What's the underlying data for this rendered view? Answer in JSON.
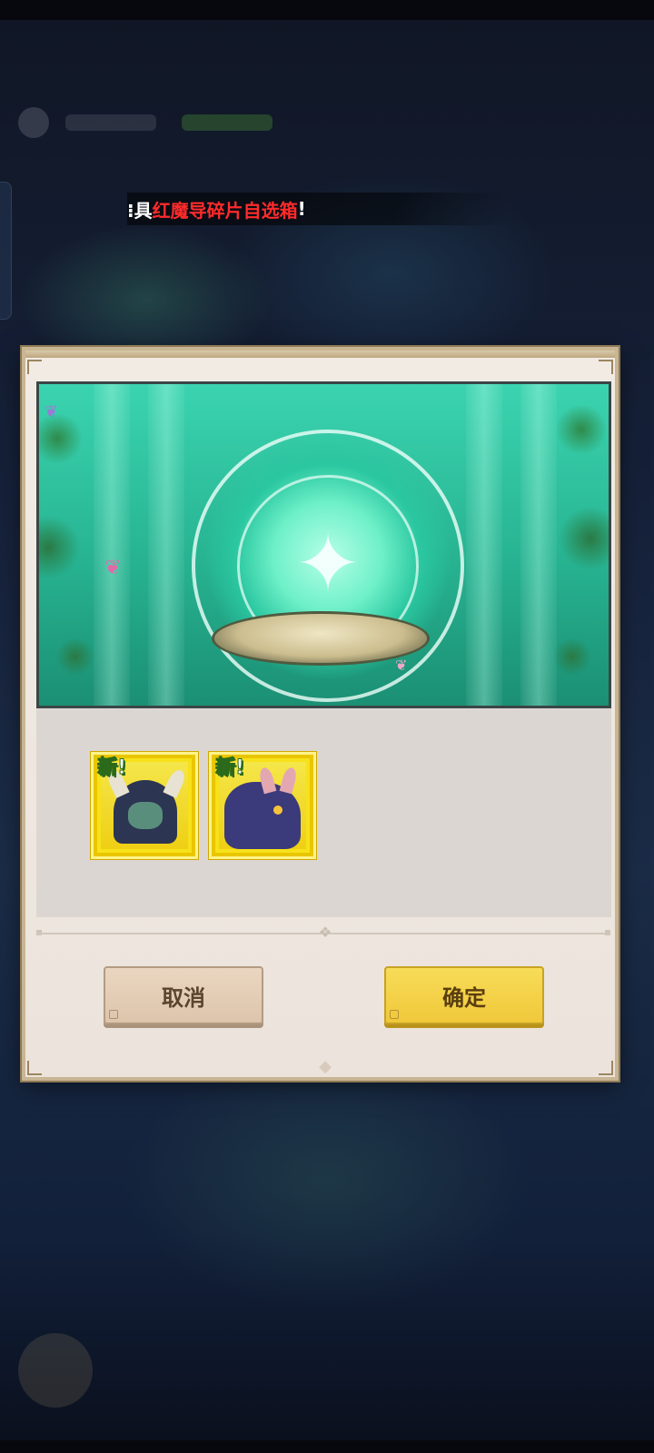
{
  "marquee": {
    "prefix": "⁝具",
    "highlight": "红魔导碎片自选箱",
    "suffix": "!"
  },
  "dialog": {
    "rewards": [
      {
        "new_label": "新!",
        "icon": "hooded-horned-mage-portrait"
      },
      {
        "new_label": "新!",
        "icon": "purple-dragon-beast-portrait"
      }
    ],
    "cancel_label": "取消",
    "confirm_label": "确定"
  },
  "colors": {
    "highlight_text": "#ff2b2b",
    "confirm_button": "#f0c83a",
    "cancel_button": "#ddc5ac",
    "reward_frame": "#f7e11a"
  }
}
